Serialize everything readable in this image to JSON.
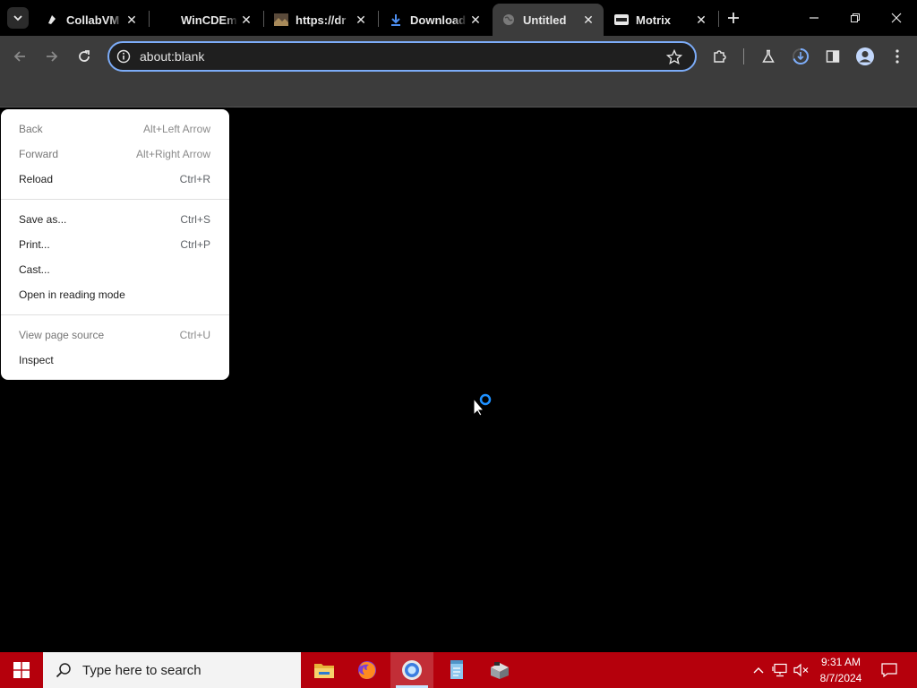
{
  "tabs": [
    {
      "title": "CollabVM",
      "favicon": "collabvm-icon"
    },
    {
      "title": "WinCDEmu",
      "favicon": "wincdemu-icon"
    },
    {
      "title": "https://dr",
      "favicon": "image-icon"
    },
    {
      "title": "Download",
      "favicon": "download-icon"
    },
    {
      "title": "Untitled",
      "favicon": "globe-icon",
      "active": true
    },
    {
      "title": "Motrix",
      "favicon": "motrix-icon"
    }
  ],
  "omnibox": {
    "url": "about:blank"
  },
  "context_menu": {
    "groups": [
      [
        {
          "label": "Back",
          "shortcut": "Alt+Left Arrow",
          "disabled": true
        },
        {
          "label": "Forward",
          "shortcut": "Alt+Right Arrow",
          "disabled": true
        },
        {
          "label": "Reload",
          "shortcut": "Ctrl+R",
          "disabled": false
        }
      ],
      [
        {
          "label": "Save as...",
          "shortcut": "Ctrl+S",
          "disabled": false
        },
        {
          "label": "Print...",
          "shortcut": "Ctrl+P",
          "disabled": false
        },
        {
          "label": "Cast...",
          "shortcut": "",
          "disabled": false
        },
        {
          "label": "Open in reading mode",
          "shortcut": "",
          "disabled": false
        }
      ],
      [
        {
          "label": "View page source",
          "shortcut": "Ctrl+U",
          "disabled": true
        },
        {
          "label": "Inspect",
          "shortcut": "",
          "disabled": false
        }
      ]
    ]
  },
  "taskbar": {
    "search_placeholder": "Type here to search",
    "apps": [
      "file-explorer-icon",
      "firefox-icon",
      "chrome-icon",
      "notepad-icon",
      "package-icon"
    ],
    "time": "9:31 AM",
    "date": "8/7/2024"
  },
  "colors": {
    "taskbar": "#b5000c",
    "toolbar": "#3c3c3c",
    "accent": "#7cacf8"
  }
}
